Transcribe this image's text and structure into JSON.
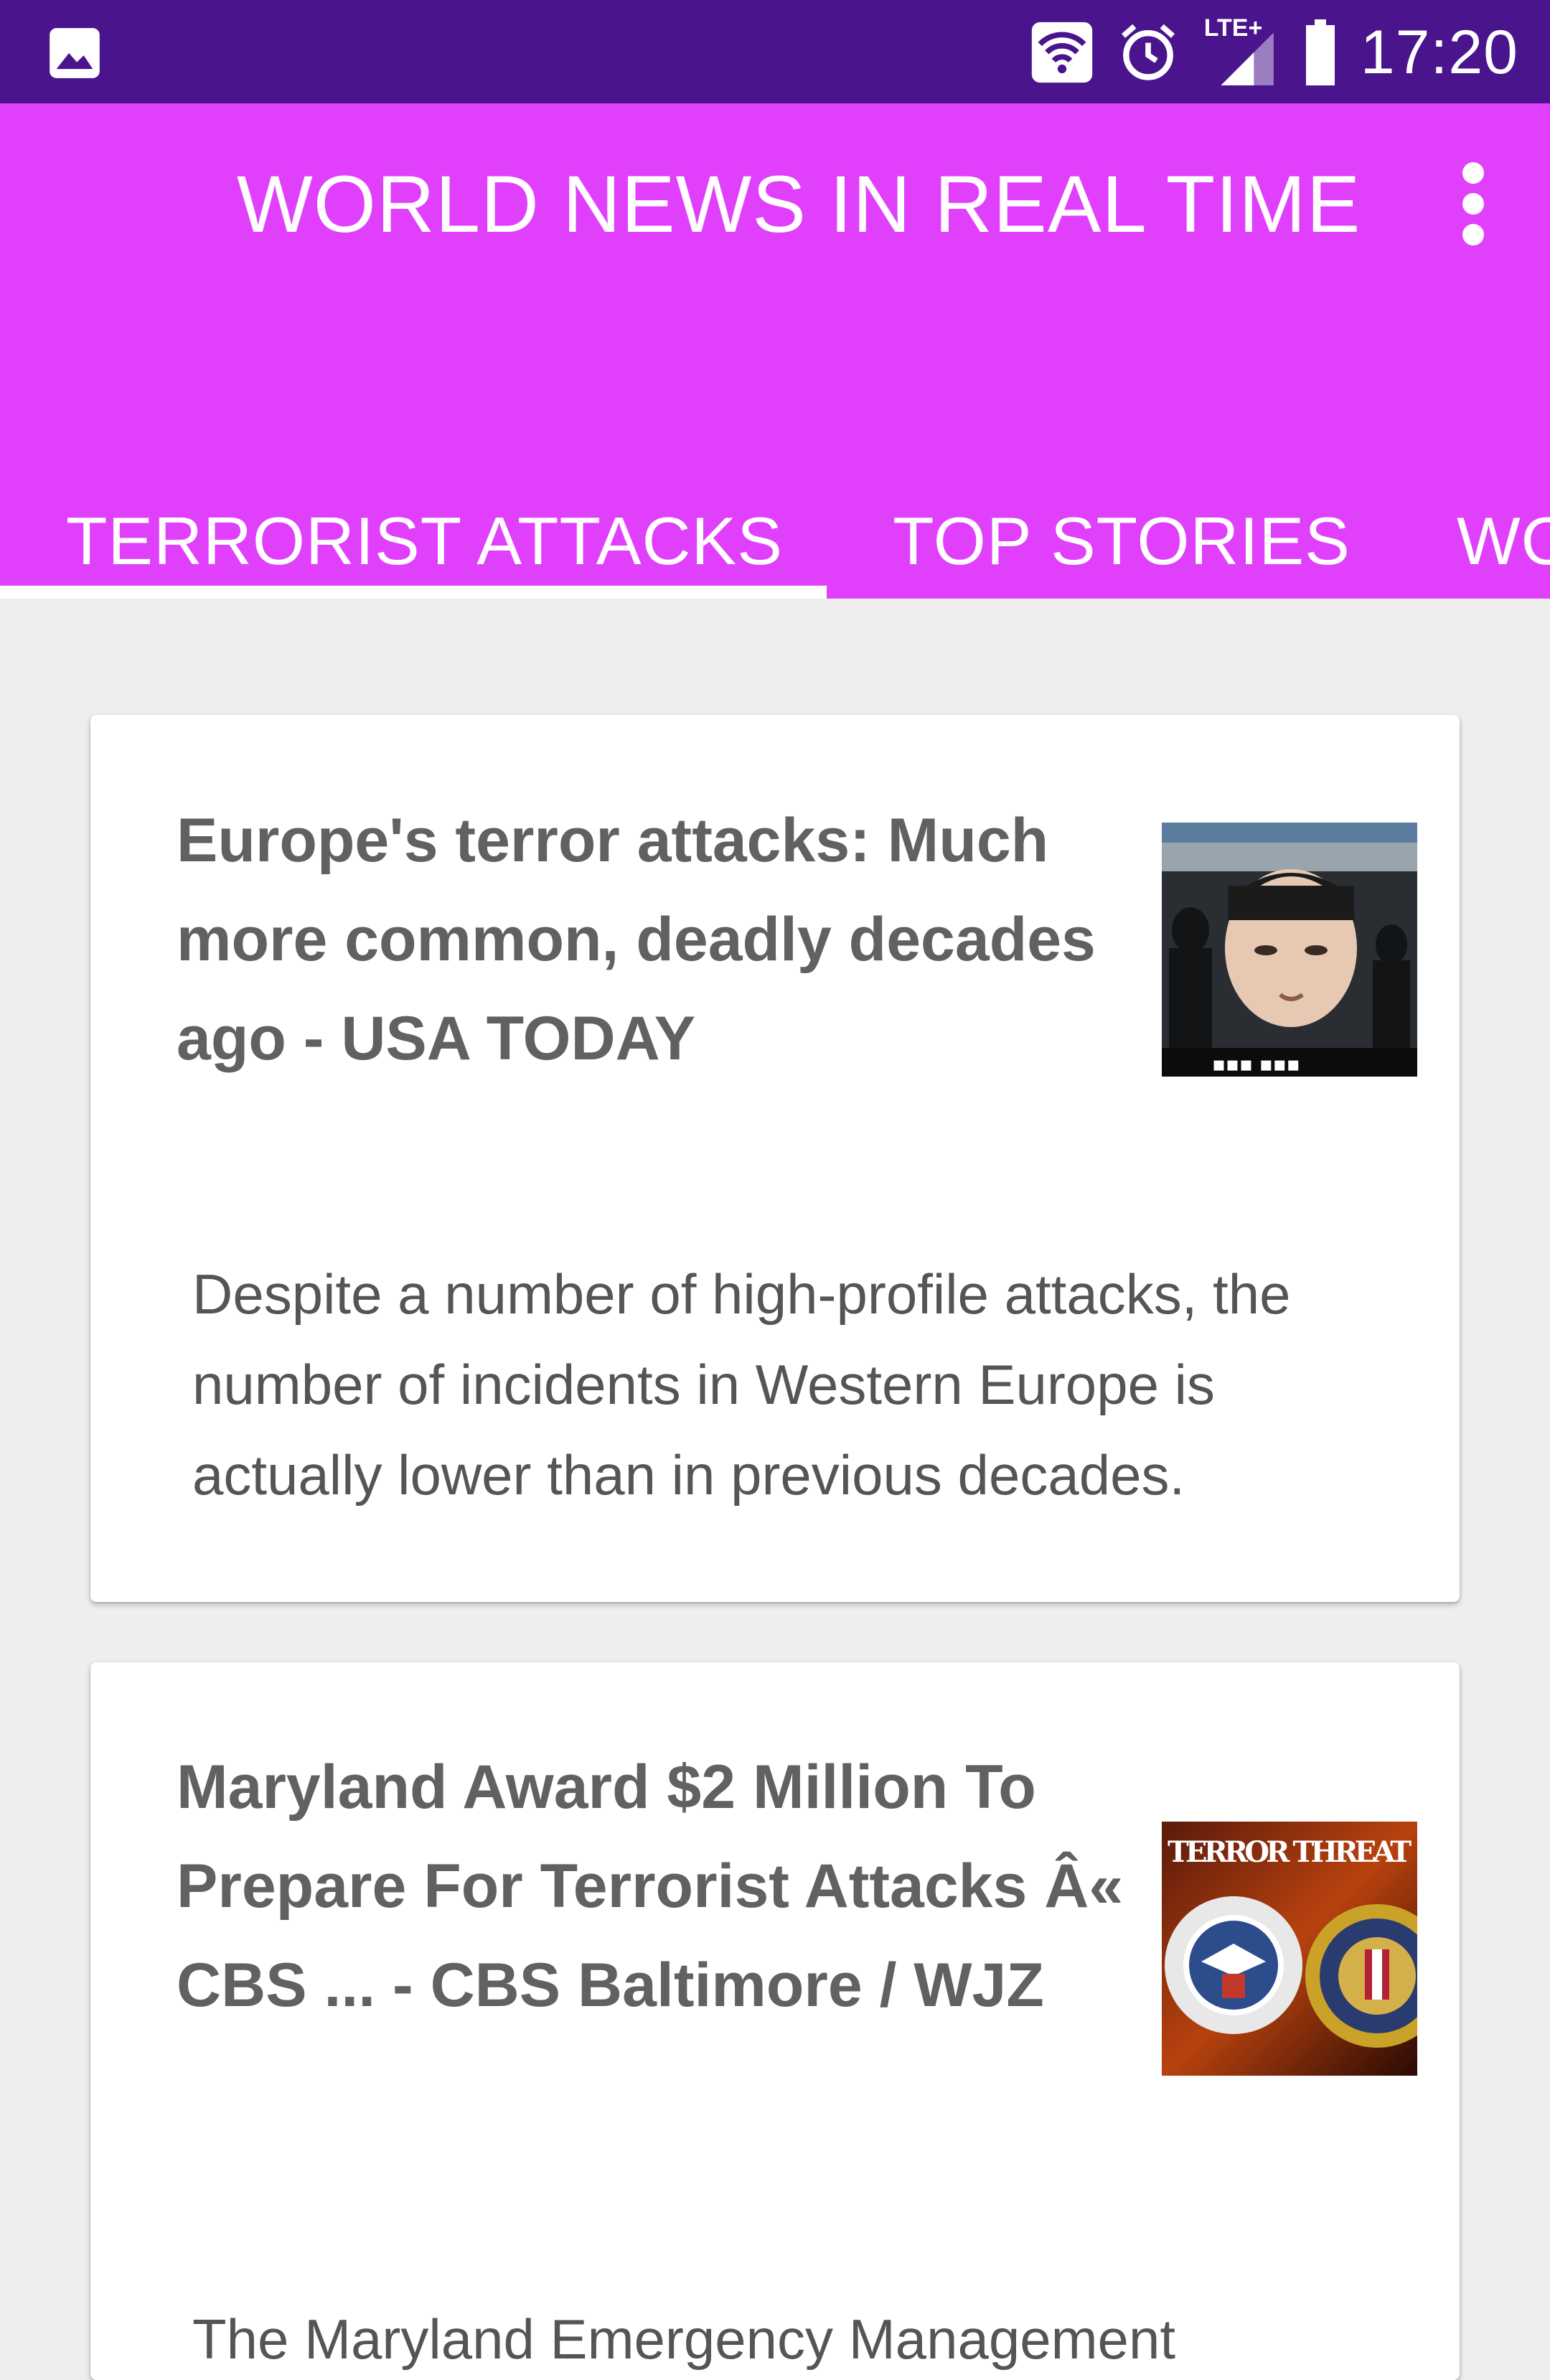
{
  "status_bar": {
    "time": "17:20",
    "network": "LTE+",
    "icons": [
      "gallery-notification-icon",
      "wifi-icon",
      "alarm-icon",
      "signal-icon",
      "battery-icon"
    ]
  },
  "app_bar": {
    "title": "WORLD NEWS IN REAL TIME",
    "overflow_icon": "more-vert-icon",
    "background": "#e040fb",
    "status_bar_color": "#4a148c"
  },
  "tabs": [
    {
      "label": "TERRORIST ATTACKS",
      "selected": true
    },
    {
      "label": "TOP STORIES",
      "selected": false
    },
    {
      "label": "WO",
      "selected": false
    }
  ],
  "articles": [
    {
      "title": "Europe's terror attacks: Much more common, deadly decades ago - USA TODAY",
      "description": "Despite a number of high-profile attacks, the number of incidents in Western Europe is actually lower than in previous decades.",
      "thumbnail": "news-thumbnail-portrait"
    },
    {
      "title": "Maryland Award $2 Million To Prepare For Terrorist Attacks Â« CBS ... - CBS Baltimore / WJZ",
      "thumbnail_caption": "TERROR THREAT",
      "thumbnail": "news-thumbnail-seals",
      "description": "The Maryland Emergency Management"
    }
  ]
}
